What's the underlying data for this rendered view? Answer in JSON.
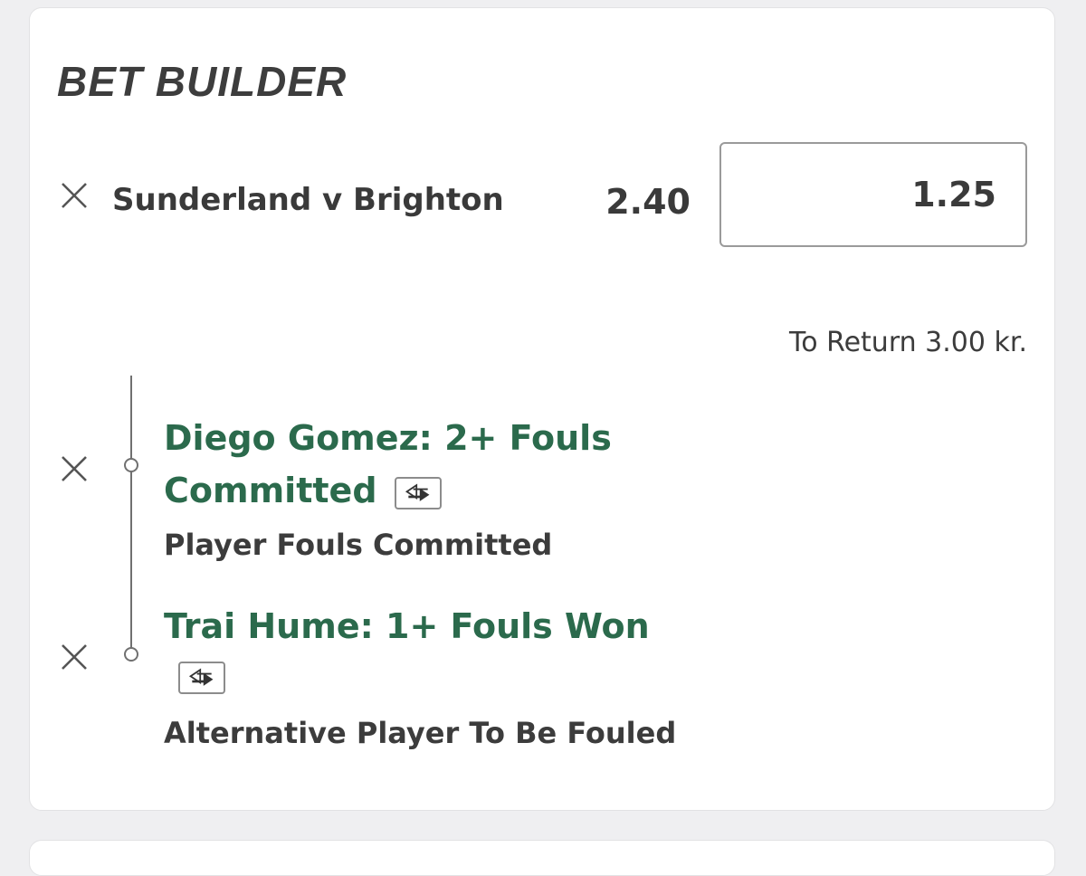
{
  "bet_builder": {
    "title": "BET BUILDER",
    "match": "Sunderland v Brighton",
    "odds": "2.40",
    "stake": "1.25",
    "to_return": "To Return 3.00 kr.",
    "selections": [
      {
        "title_line1": "Diego Gomez: 2+ Fouls",
        "title_line2": "Committed",
        "market": "Player Fouls Committed"
      },
      {
        "title_line1": "Trai Hume: 1+ Fouls Won",
        "market": "Alternative Player To Be Fouled"
      }
    ]
  },
  "colors": {
    "selection_green": "#2b6a4c",
    "text_dark": "#3a3a3a",
    "background": "#efeff1"
  },
  "icons": [
    "close-icon",
    "swap-icon"
  ]
}
